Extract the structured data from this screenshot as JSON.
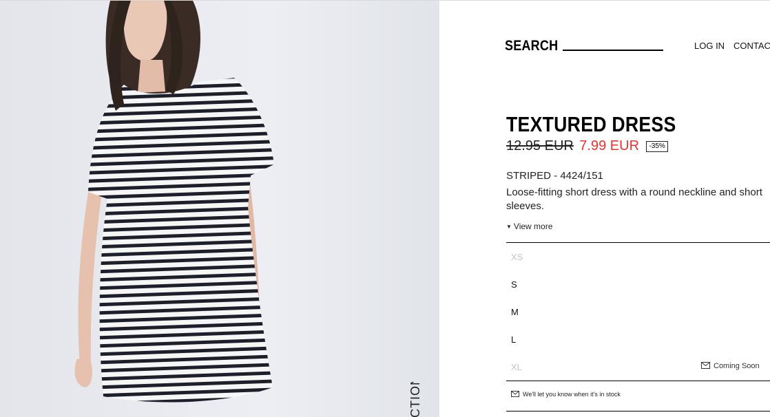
{
  "header": {
    "search_label": "SEARCH",
    "search_value": "",
    "nav": {
      "login": "LOG IN",
      "contact": "CONTACT"
    }
  },
  "image": {
    "vertical_label": "CTION"
  },
  "product": {
    "title": "TEXTURED DRESS",
    "old_price": "12.95 EUR",
    "new_price": "7.99 EUR",
    "discount": "-35%",
    "color_ref": "STRIPED - 4424/151",
    "description": "Loose-fitting short dress with a round neckline and short sleeves.",
    "view_more": "View more"
  },
  "sizes": [
    {
      "label": "XS",
      "available": false
    },
    {
      "label": "S",
      "available": true
    },
    {
      "label": "M",
      "available": true
    },
    {
      "label": "L",
      "available": true
    },
    {
      "label": "XL",
      "available": false,
      "status": "Coming Soon"
    }
  ],
  "notify_text": "We'll let you know when it's in stock",
  "colors": {
    "sale_price": "#e5322d",
    "unavailable_size": "#c4c4c4",
    "image_background": "#e7e9ef"
  }
}
